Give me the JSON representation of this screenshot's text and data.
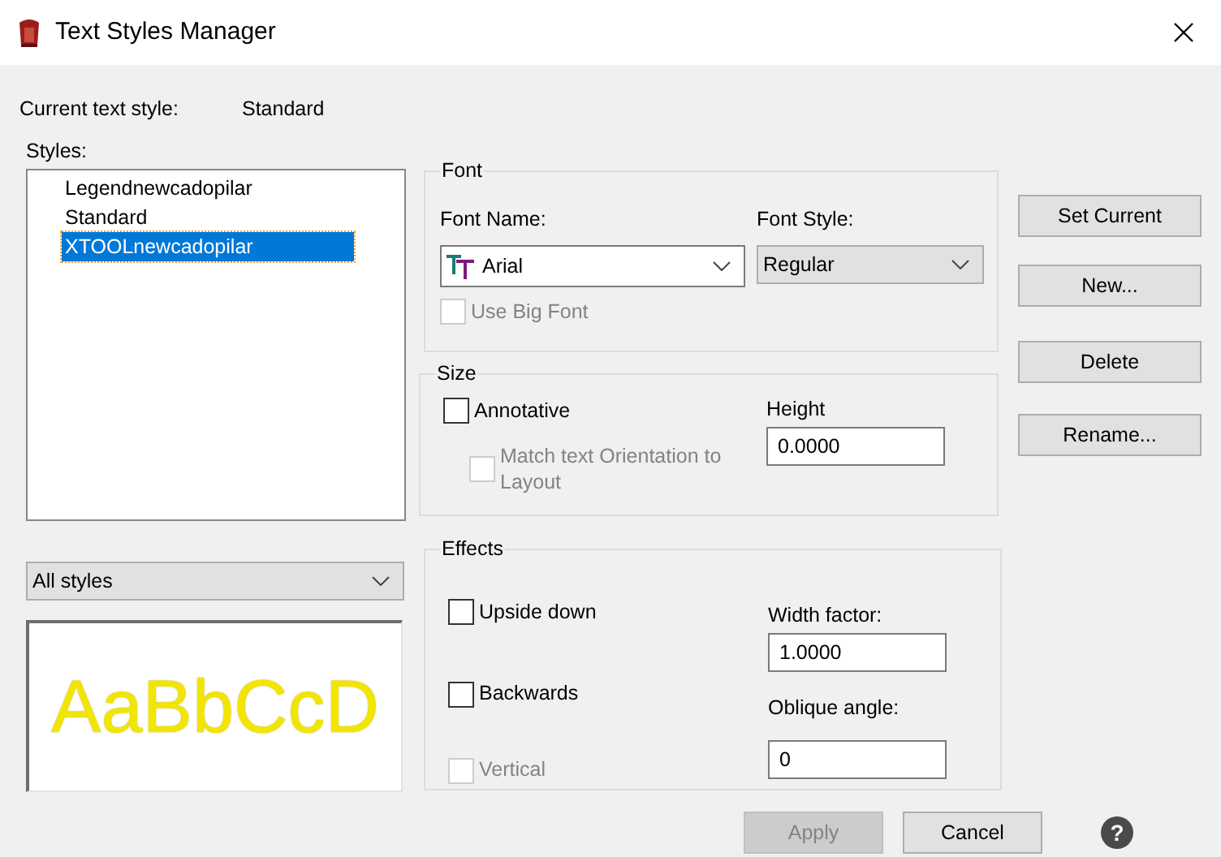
{
  "window": {
    "title": "Text Styles Manager"
  },
  "current_style": {
    "label": "Current text style:",
    "value": "Standard"
  },
  "styles": {
    "label": "Styles:",
    "items": [
      {
        "name": "Legendnewcadopilar",
        "selected": false
      },
      {
        "name": "Standard",
        "selected": false
      },
      {
        "name": "XTOOLnewcadopilar",
        "selected": true
      }
    ]
  },
  "filter": {
    "value": "All styles"
  },
  "preview": {
    "sample": "AaBbCcD"
  },
  "font": {
    "title": "Font",
    "font_name": {
      "label": "Font Name:",
      "value": "Arial"
    },
    "font_style": {
      "label": "Font Style:",
      "value": "Regular"
    },
    "use_big_font": {
      "label": "Use Big Font",
      "checked": false,
      "disabled": true
    }
  },
  "size": {
    "title": "Size",
    "annotative": {
      "label": "Annotative",
      "checked": false,
      "disabled": false
    },
    "match_orientation": {
      "label": "Match text Orientation to Layout",
      "checked": false,
      "disabled": true
    },
    "height": {
      "label": "Height",
      "value": "0.0000"
    }
  },
  "effects": {
    "title": "Effects",
    "upside_down": {
      "label": "Upside down",
      "checked": false,
      "disabled": false
    },
    "backwards": {
      "label": "Backwards",
      "checked": false,
      "disabled": false
    },
    "vertical": {
      "label": "Vertical",
      "checked": false,
      "disabled": true
    },
    "width_factor": {
      "label": "Width factor:",
      "value": "1.0000"
    },
    "oblique_angle": {
      "label": "Oblique angle:",
      "value": "0"
    }
  },
  "side_buttons": [
    {
      "label": "Set Current"
    },
    {
      "label": "New..."
    },
    {
      "label": "Delete"
    },
    {
      "label": "Rename..."
    }
  ],
  "footer_buttons": [
    {
      "label": "Apply",
      "disabled": true
    },
    {
      "label": "Cancel",
      "disabled": false
    }
  ],
  "help_button": {
    "label": "?"
  }
}
